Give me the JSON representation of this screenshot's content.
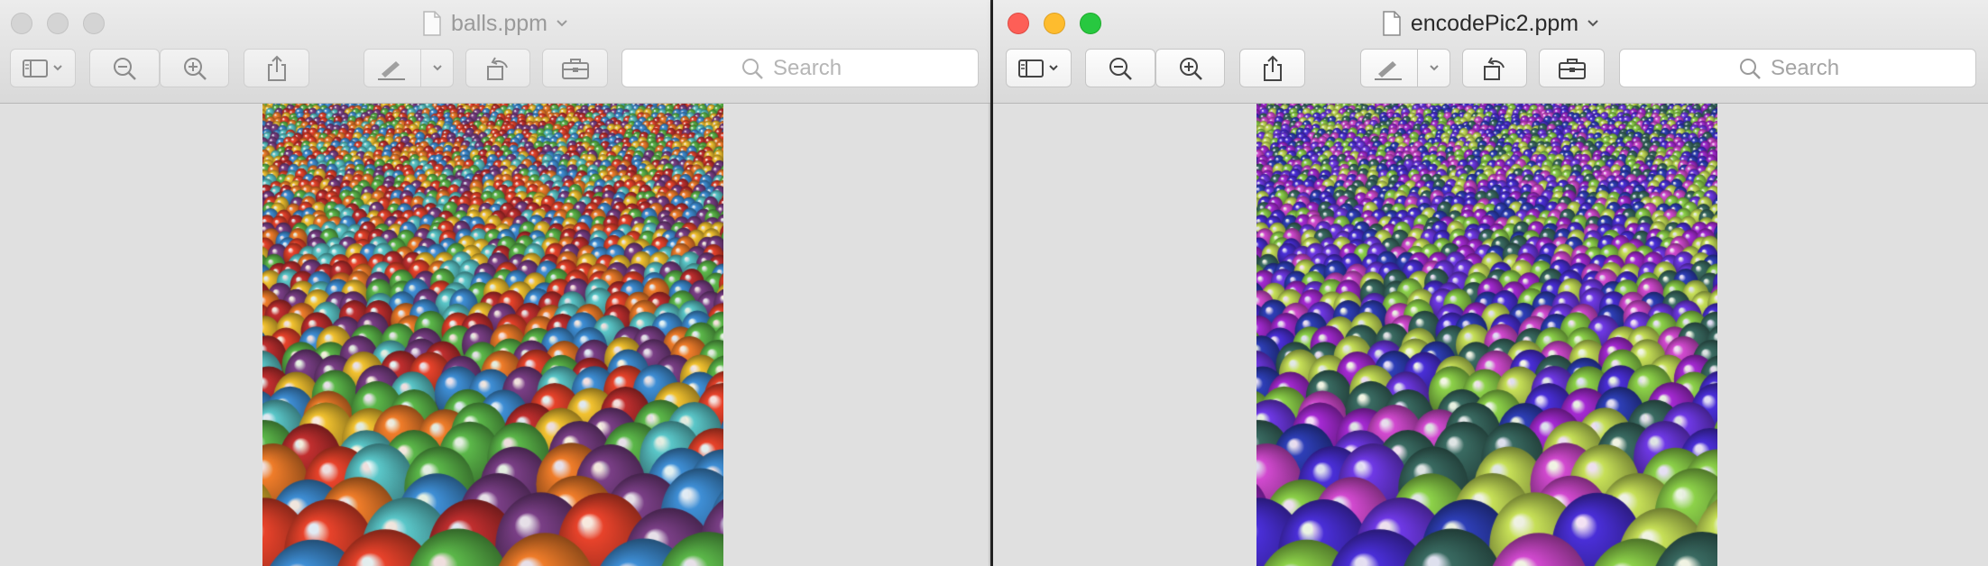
{
  "windows": [
    {
      "id": "left",
      "state": "inactive",
      "title": "balls.ppm",
      "toolbar": {
        "sidebar_icon": "sidebar-icon",
        "zoom_out_icon": "zoom-out-icon",
        "zoom_in_icon": "zoom-in-icon",
        "share_icon": "share-icon",
        "markup_icon": "markup-pen-icon",
        "rotate_icon": "rotate-icon",
        "toolbox_icon": "toolbox-icon",
        "search_placeholder": "Search"
      },
      "image": {
        "subject": "ball-pit photo",
        "palette": [
          "#e8432b",
          "#3f8fd6",
          "#f2c230",
          "#5cb84a",
          "#7a3f86",
          "#5bc7c9",
          "#c12f2f",
          "#f07d2a"
        ]
      }
    },
    {
      "id": "right",
      "state": "active",
      "title": "encodePic2.ppm",
      "toolbar": {
        "sidebar_icon": "sidebar-icon",
        "zoom_out_icon": "zoom-out-icon",
        "zoom_in_icon": "zoom-in-icon",
        "share_icon": "share-icon",
        "markup_icon": "markup-pen-icon",
        "rotate_icon": "rotate-icon",
        "toolbox_icon": "toolbox-icon",
        "search_placeholder": "Search"
      },
      "image": {
        "subject": "color-shifted ball-pit photo",
        "palette": [
          "#4a2fd8",
          "#8dd24a",
          "#a52ad3",
          "#3a6b62",
          "#c7e058",
          "#6f39e6",
          "#2e3fb8",
          "#d24ad0"
        ]
      }
    }
  ],
  "colors": {
    "close": "#fd5f57",
    "minimize": "#febc2e",
    "zoom": "#28c840",
    "inactive_light": "#d4d4d4"
  }
}
